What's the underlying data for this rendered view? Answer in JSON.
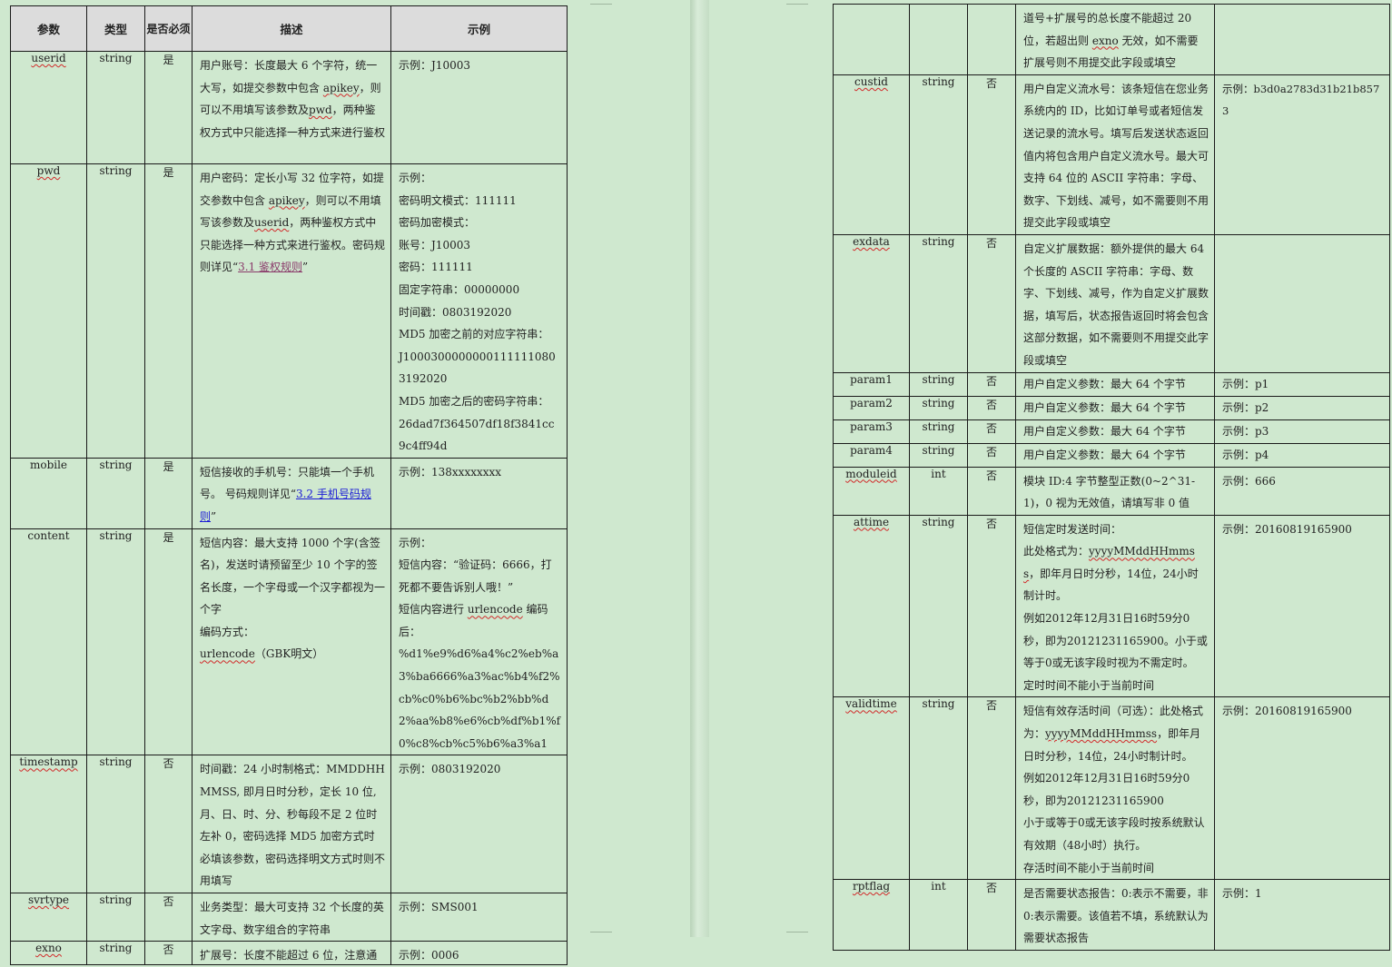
{
  "left_table": {
    "headers": {
      "param": "参数",
      "type": "类型",
      "required": "是否必须",
      "desc": "描述",
      "example": "示例"
    },
    "rows": {
      "userid": {
        "name": "userid",
        "type": "string",
        "required": "是",
        "desc_1": "用户账号：长度最大 6 个字符，统一大写，如提交参数中包含",
        "desc_apikey": "apikey",
        "desc_2": "，则可以不用填写该参数及",
        "desc_pwd": "pwd",
        "desc_3": "，两种鉴权方式中只能选择一种方式来进行鉴权",
        "example": "示例：J10003"
      },
      "pwd": {
        "name": "pwd",
        "type": "string",
        "required": "是",
        "desc_1": "用户密码：定长小写 32 位字符，如提交参数中包含",
        "desc_apikey": "apikey",
        "desc_2": "，则可以不用填写该参数及",
        "desc_userid": "userid",
        "desc_3": "，两种鉴权方式中只能选择一种方式来进行鉴权。密码规则详见“",
        "desc_link": "3.1 鉴权规则",
        "desc_4": "”",
        "example_lines": [
          "示例：",
          "密码明文模式：111111",
          "密码加密模式：",
          "账号：J10003",
          "密码：111111",
          "固定字符串：00000000",
          "时间戳：0803192020",
          "MD5 加密之前的对应字符串：",
          "J10003000000001111110803192020",
          "MD5 加密之后的密码字符串：",
          "26dad7f364507df18f3841cc9c4ff94d"
        ]
      },
      "mobile": {
        "name": "mobile",
        "type": "string",
        "required": "是",
        "desc_1": "短信接收的手机号：只能填一个手机号。  号码规则详见“",
        "desc_link": "3.2 手机号码规则",
        "desc_2": "”",
        "example": "示例：138xxxxxxxx"
      },
      "content": {
        "name": "content",
        "type": "string",
        "required": "是",
        "desc_1": "短信内容：最大支持 1000 个字(含签名)，发送时请预留至少 10 个字的签名长度，一个字母或一个汉字都视为一个字",
        "desc_2": "编码方式：",
        "desc_3a": "urlencode",
        "desc_3b": "（GBK明文）",
        "example_1": "示例：",
        "example_2": "短信内容：“验证码：6666，打死都不要告诉别人哦！”",
        "example_3a": "短信内容进行",
        "example_3b": "urlencode",
        "example_3c": "编码后：",
        "example_4": "%d1%e9%d6%a4%c2%eb%a3%ba6666%a3%ac%b4%f2%cb%c0%b6%bc%b2%bb%d2%aa%b8%e6%cb%df%b1%f0%c8%cb%c5%b6%a3%a1"
      },
      "timestamp": {
        "name": "timestamp",
        "type": "string",
        "required": "否",
        "desc": "时间戳：24 小时制格式：MMDDHHMMSS, 即月日时分秒，定长 10 位, 月、日、时、分、秒每段不足 2 位时左补 0，密码选择 MD5 加密方式时必填该参数，密码选择明文方式时则不用填写",
        "example": "示例：0803192020"
      },
      "svrtype": {
        "name": "svrtype",
        "type": "string",
        "required": "否",
        "desc": "业务类型：最大可支持 32 个长度的英文字母、数字组合的字符串",
        "example": "示例：SMS001"
      },
      "exno": {
        "name": "exno",
        "type": "string",
        "required": "否",
        "desc": "扩展号：长度不能超过 6 位，注意通",
        "example": "示例：0006"
      }
    }
  },
  "right_table": {
    "rows": {
      "exno_cont": {
        "desc_1": "道号+扩展号的总长度不能超过 20 位，若超出则",
        "desc_exno": "exno",
        "desc_2": "无效，如不需要扩展号则不用提交此字段或填空"
      },
      "custid": {
        "name": "custid",
        "type": "string",
        "required": "否",
        "desc": "用户自定义流水号：该条短信在您业务系统内的 ID，比如订单号或者短信发送记录的流水号。填写后发送状态返回值内将包含用户自定义流水号。最大可支持 64 位的 ASCII 字符串：字母、数字、下划线、减号，如不需要则不用提交此字段或填空",
        "example": "示例：b3d0a2783d31b21b8573"
      },
      "exdata": {
        "name": "exdata",
        "type": "string",
        "required": "否",
        "desc": "自定义扩展数据：额外提供的最大 64 个长度的 ASCII 字符串：字母、数字、下划线、减号，作为自定义扩展数据，填写后，状态报告返回时将会包含这部分数据，如不需要则不用提交此字段或填空",
        "example": ""
      },
      "param1": {
        "name": "param1",
        "type": "string",
        "required": "否",
        "desc": "用户自定义参数：最大 64 个字节",
        "example": "示例：p1"
      },
      "param2": {
        "name": "param2",
        "type": "string",
        "required": "否",
        "desc": "用户自定义参数：最大 64 个字节",
        "example": "示例：p2"
      },
      "param3": {
        "name": "param3",
        "type": "string",
        "required": "否",
        "desc": "用户自定义参数：最大 64 个字节",
        "example": "示例：p3"
      },
      "param4": {
        "name": "param4",
        "type": "string",
        "required": "否",
        "desc": "用户自定义参数：最大 64 个字节",
        "example": "示例：p4"
      },
      "moduleid": {
        "name": "moduleid",
        "type": "int",
        "required": "否",
        "desc": "模块 ID:4 字节整型正数(0~2^31-1)，0 视为无效值，请填写非 0 值",
        "example": "示例：666"
      },
      "attime": {
        "name": "attime",
        "type": "string",
        "required": "否",
        "desc_1": "短信定时发送时间：",
        "desc_2a": "此处格式为：",
        "desc_2b": "yyyyMMddHHmmss",
        "desc_2c": "，即年月日时分秒，14位，24小时制计时。",
        "desc_3": "例如2012年12月31日16时59分0秒，即为20121231165900。小于或等于0或无该字段时视为不需定时。",
        "desc_4": "定时时间不能小于当前时间",
        "example": "示例：20160819165900"
      },
      "validtime": {
        "name": "validtime",
        "type": "string",
        "required": "否",
        "desc_1a": "短信有效存活时间（可选）：此处格式为：",
        "desc_1b": "yyyyMMddHHmmss",
        "desc_1c": "，即年月日时分秒，14位，24小时制计时。",
        "desc_2": "例如2012年12月31日16时59分0秒，即为20121231165900",
        "desc_3": "小于或等于0或无该字段时按系统默认有效期（48小时）执行。",
        "desc_4": "存活时间不能小于当前时间",
        "example": "示例：20160819165900"
      },
      "rptflag": {
        "name": "rptflag",
        "type": "int",
        "required": "否",
        "desc": "是否需要状态报告：0:表示不需要，非 0:表示需要。该值若不填，系统默认为需要状态报告",
        "example": "示例：1"
      }
    }
  }
}
